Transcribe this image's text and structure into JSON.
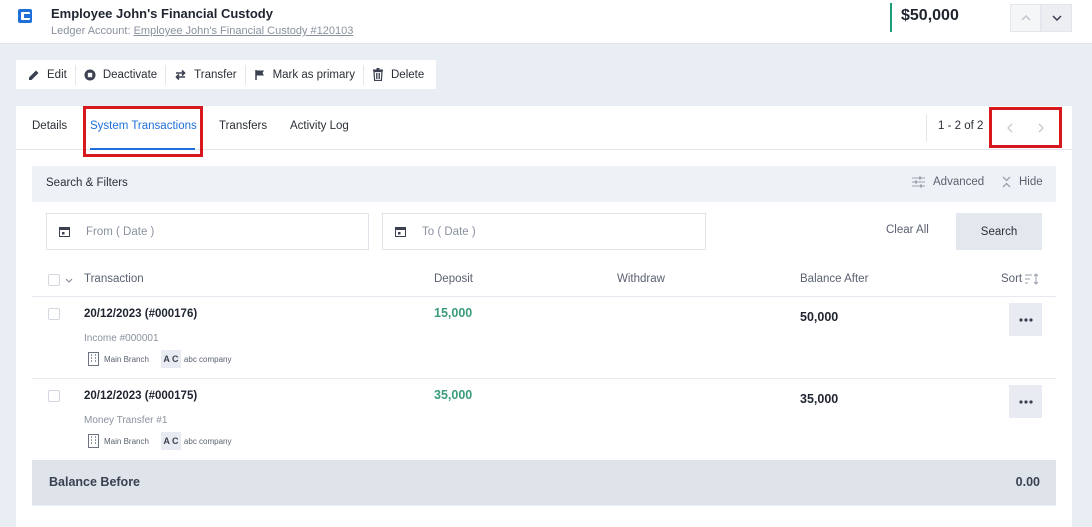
{
  "header": {
    "title": "Employee John's Financial Custody",
    "ledger_label": "Ledger Account:",
    "ledger_link": "Employee John's Financial Custody #120103",
    "amount": "$50,000"
  },
  "toolbar": {
    "edit": "Edit",
    "deactivate": "Deactivate",
    "transfer": "Transfer",
    "mark_primary": "Mark as primary",
    "delete": "Delete"
  },
  "tabs": {
    "details": "Details",
    "system_transactions": "System Transactions",
    "transfers": "Transfers",
    "activity_log": "Activity Log"
  },
  "pager": {
    "text": "1 - 2 of 2"
  },
  "filters": {
    "title": "Search & Filters",
    "advanced": "Advanced",
    "hide": "Hide",
    "from_placeholder": "From ( Date )",
    "to_placeholder": "To ( Date )",
    "clear_all": "Clear All",
    "search": "Search"
  },
  "table": {
    "columns": {
      "transaction": "Transaction",
      "deposit": "Deposit",
      "withdraw": "Withdraw",
      "balance_after": "Balance After",
      "sort": "Sort"
    },
    "rows": [
      {
        "title": "20/12/2023 (#000176)",
        "subtitle": "Income #000001",
        "branch": "Main Branch",
        "company_badge": "A C",
        "company": "abc company",
        "deposit": "15,000",
        "withdraw": "",
        "balance_after": "50,000"
      },
      {
        "title": "20/12/2023 (#000175)",
        "subtitle": "Money Transfer #1",
        "branch": "Main Branch",
        "company_badge": "A C",
        "company": "abc company",
        "deposit": "35,000",
        "withdraw": "",
        "balance_after": "35,000"
      }
    ],
    "balance_before_label": "Balance Before",
    "balance_before_value": "0.00"
  },
  "colors": {
    "accent_blue": "#1e6fd9",
    "deposit_green": "#3a9c7c",
    "highlight_red": "#d7191f"
  }
}
